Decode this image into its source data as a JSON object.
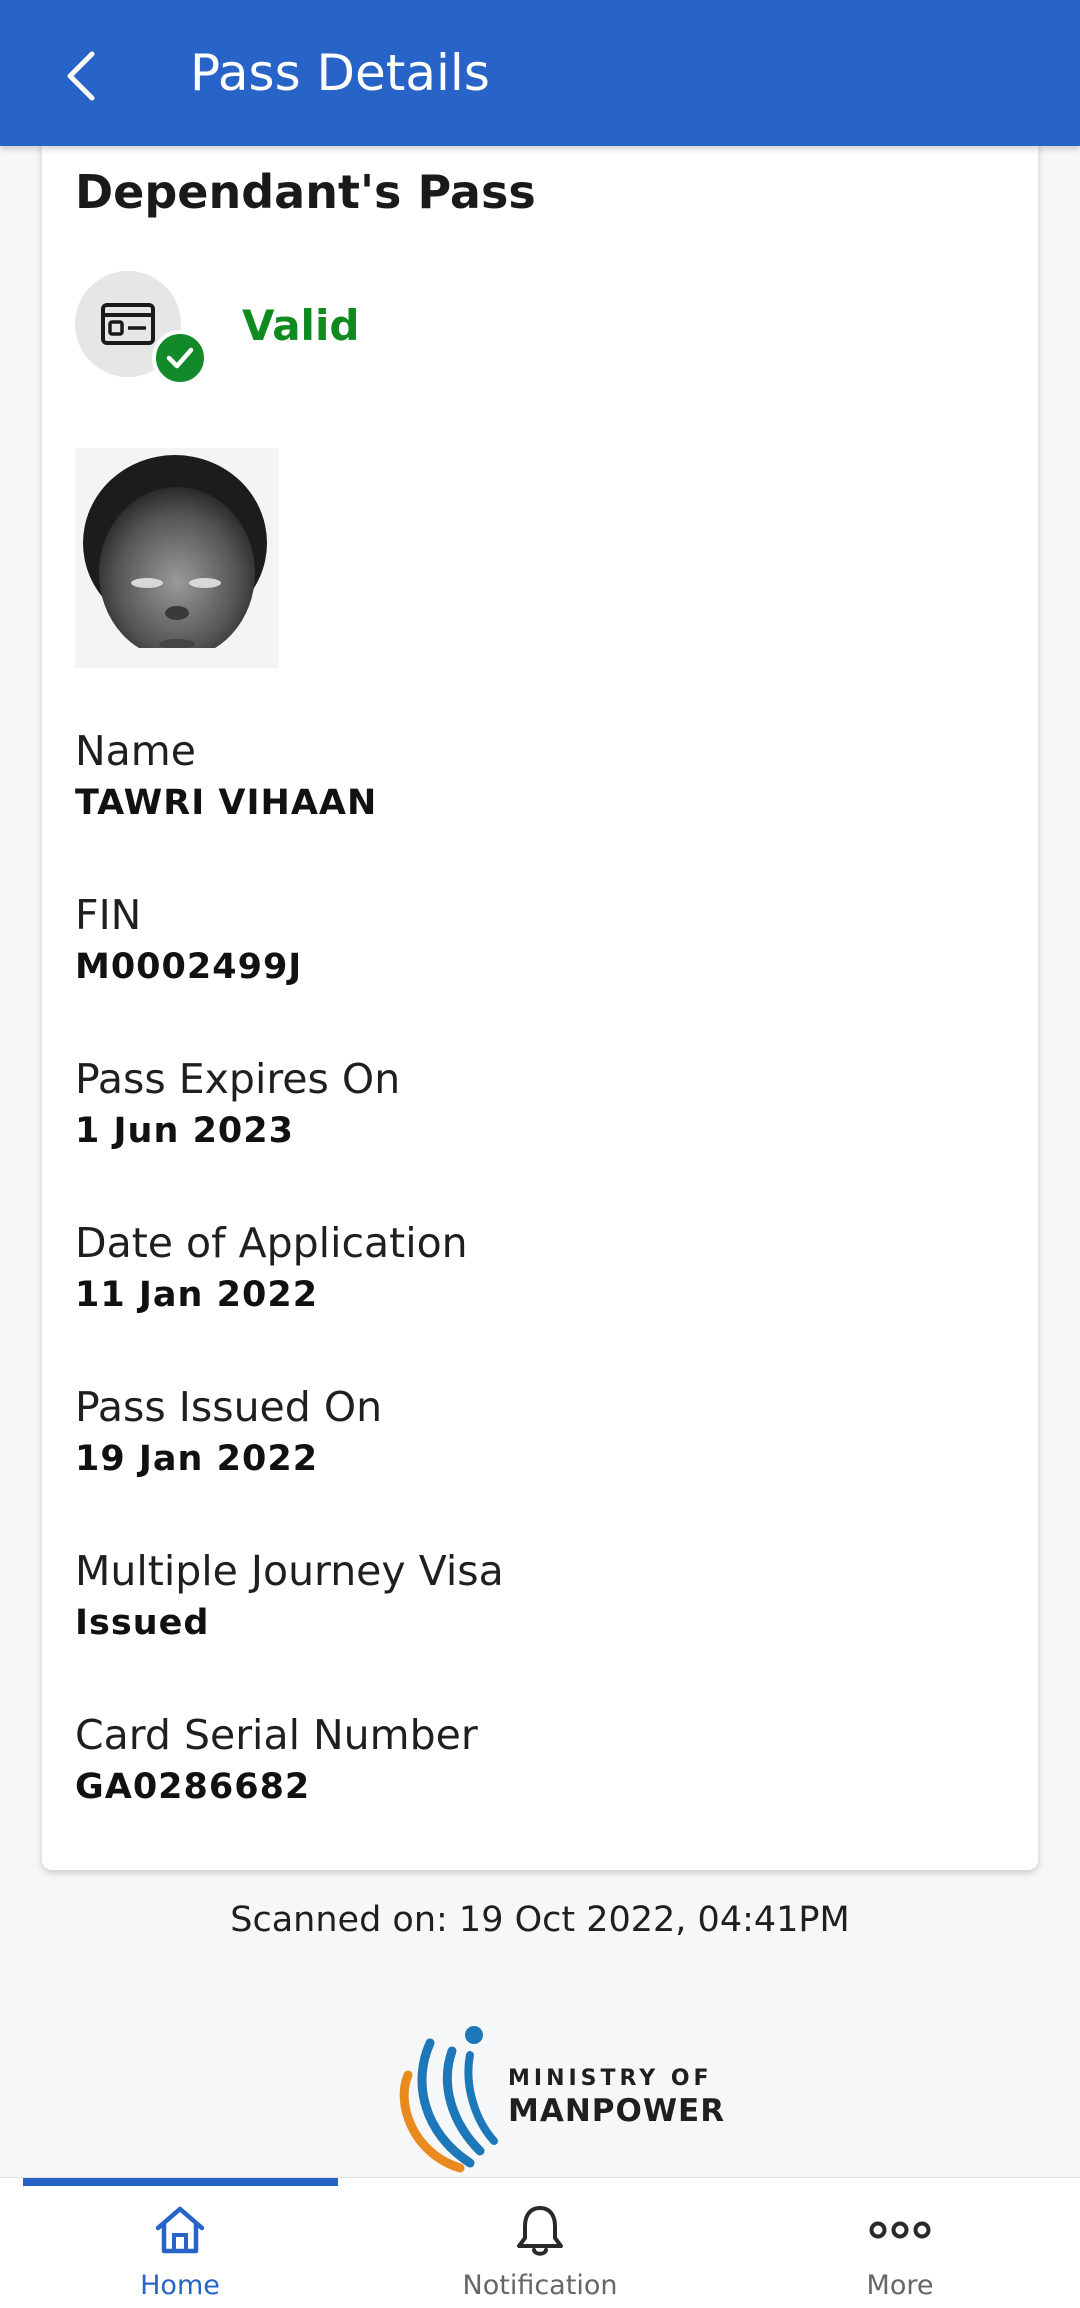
{
  "header": {
    "title": "Pass Details"
  },
  "pass": {
    "type": "Dependant's Pass",
    "status": "Valid"
  },
  "fields": [
    {
      "label": "Name",
      "value": "TAWRI VIHAAN"
    },
    {
      "label": "FIN",
      "value": "M0002499J"
    },
    {
      "label": "Pass Expires On",
      "value": "1 Jun 2023"
    },
    {
      "label": "Date of Application",
      "value": "11 Jan 2022"
    },
    {
      "label": "Pass Issued On",
      "value": "19 Jan 2022"
    },
    {
      "label": "Multiple Journey Visa",
      "value": "Issued"
    },
    {
      "label": "Card Serial Number",
      "value": "GA0286682"
    }
  ],
  "scanned": "Scanned on: 19 Oct 2022, 04:41PM",
  "logo": {
    "line1": "MINISTRY OF",
    "line2": "MANPOWER"
  },
  "nav": {
    "items": [
      {
        "label": "Home",
        "icon": "home-icon",
        "active": true
      },
      {
        "label": "Notification",
        "icon": "bell-icon",
        "active": false
      },
      {
        "label": "More",
        "icon": "more-icon",
        "active": false
      }
    ]
  },
  "colors": {
    "brand": "#2864c8",
    "valid": "#0e8a1e",
    "nav_inactive": "#666666"
  }
}
